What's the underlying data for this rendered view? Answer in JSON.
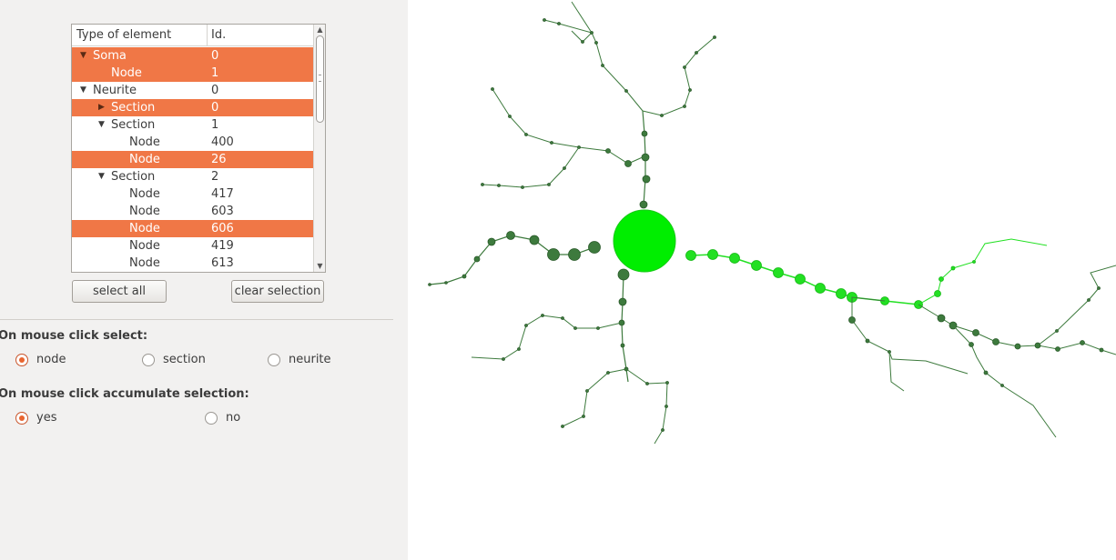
{
  "tree": {
    "headers": [
      "Type of element",
      "Id."
    ],
    "rows": [
      {
        "label": "Soma",
        "id": "0",
        "depth": 0,
        "arrow": "▼",
        "selected": true
      },
      {
        "label": "Node",
        "id": "1",
        "depth": 1,
        "arrow": "",
        "selected": true
      },
      {
        "label": "Neurite",
        "id": "0",
        "depth": 0,
        "arrow": "▼",
        "selected": false
      },
      {
        "label": "Section",
        "id": "0",
        "depth": 1,
        "arrow": "▶",
        "selected": true
      },
      {
        "label": "Section",
        "id": "1",
        "depth": 1,
        "arrow": "▼",
        "selected": false
      },
      {
        "label": "Node",
        "id": "400",
        "depth": 2,
        "arrow": "",
        "selected": false
      },
      {
        "label": "Node",
        "id": "26",
        "depth": 2,
        "arrow": "",
        "selected": true
      },
      {
        "label": "Section",
        "id": "2",
        "depth": 1,
        "arrow": "▼",
        "selected": false
      },
      {
        "label": "Node",
        "id": "417",
        "depth": 2,
        "arrow": "",
        "selected": false
      },
      {
        "label": "Node",
        "id": "603",
        "depth": 2,
        "arrow": "",
        "selected": false
      },
      {
        "label": "Node",
        "id": "606",
        "depth": 2,
        "arrow": "",
        "selected": true
      },
      {
        "label": "Node",
        "id": "419",
        "depth": 2,
        "arrow": "",
        "selected": false
      },
      {
        "label": "Node",
        "id": "613",
        "depth": 2,
        "arrow": "",
        "selected": false
      }
    ]
  },
  "buttons": {
    "select_all": "select all",
    "clear_selection": "clear selection"
  },
  "select_group": {
    "title": "On mouse click select:",
    "options": [
      {
        "label": "node",
        "checked": true
      },
      {
        "label": "section",
        "checked": false
      },
      {
        "label": "neurite",
        "checked": false
      }
    ]
  },
  "accumulate_group": {
    "title": "On mouse click accumulate selection:",
    "options": [
      {
        "label": "yes",
        "checked": true
      },
      {
        "label": "no",
        "checked": false
      }
    ]
  },
  "colors": {
    "selection": "#f07746",
    "soma": "#00ee00",
    "selected_neurite": "#22e022",
    "neurite": "#3d7a3d",
    "radio_accent": "#e9652f"
  }
}
